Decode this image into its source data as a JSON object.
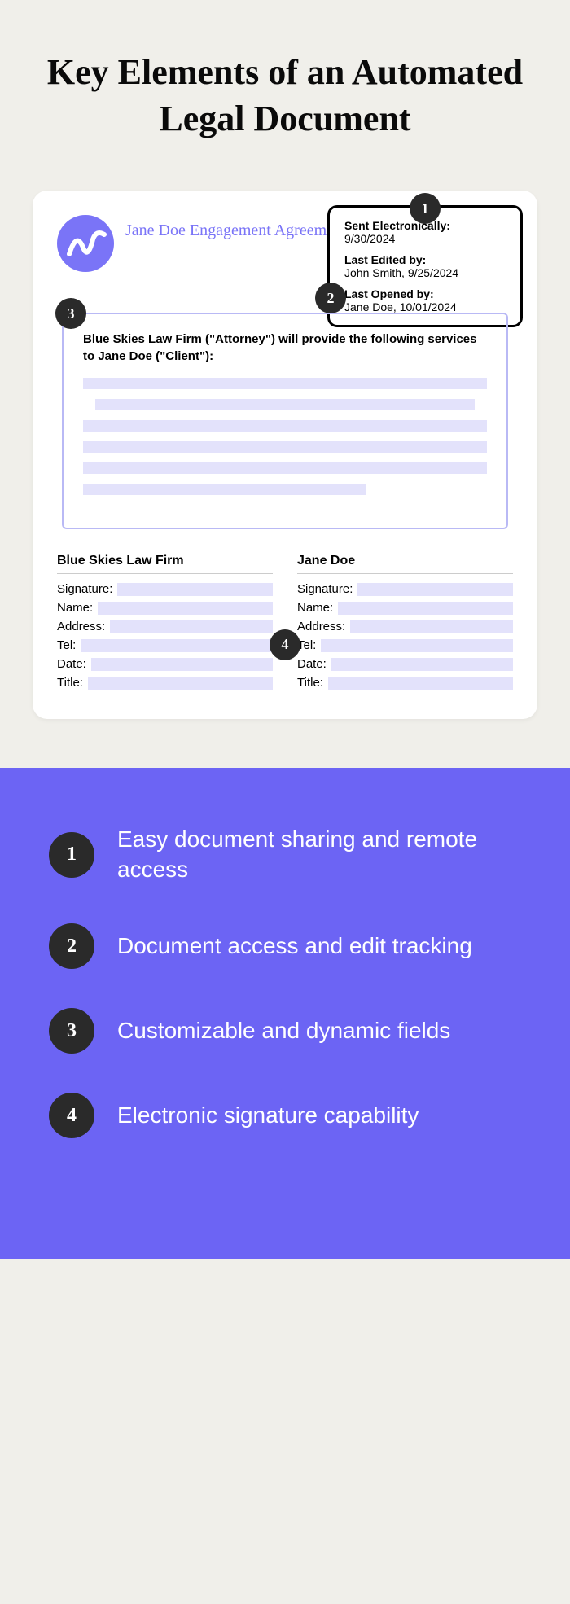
{
  "title": "Key Elements of an Automated Legal Document",
  "docTitle": "Jane Doe Engagement Agreement",
  "meta": {
    "sentLabel": "Sent Electronically:",
    "sentValue": "9/30/2024",
    "editedLabel": "Last Edited by:",
    "editedValue": "John Smith, 9/25/2024",
    "openedLabel": "Last Opened by:",
    "openedValue": "Jane Doe, 10/01/2024"
  },
  "contentText": "Blue Skies Law Firm (\"Attorney\") will provide the following services to Jane Doe (\"Client\"):",
  "sigA": {
    "header": "Blue Skies Law Firm",
    "fields": [
      "Signature:",
      "Name:",
      "Address:",
      "Tel:",
      "Date:",
      "Title:"
    ]
  },
  "sigB": {
    "header": "Jane Doe",
    "fields": [
      "Signature:",
      "Name:",
      "Address:",
      "Tel:",
      "Date:",
      "Title:"
    ]
  },
  "badges": {
    "b1": "1",
    "b2": "2",
    "b3": "3",
    "b4": "4"
  },
  "features": [
    {
      "num": "1",
      "text": "Easy document sharing and remote access"
    },
    {
      "num": "2",
      "text": "Document access and edit tracking"
    },
    {
      "num": "3",
      "text": "Customizable and dynamic fields"
    },
    {
      "num": "4",
      "text": "Electronic signature capability"
    }
  ]
}
